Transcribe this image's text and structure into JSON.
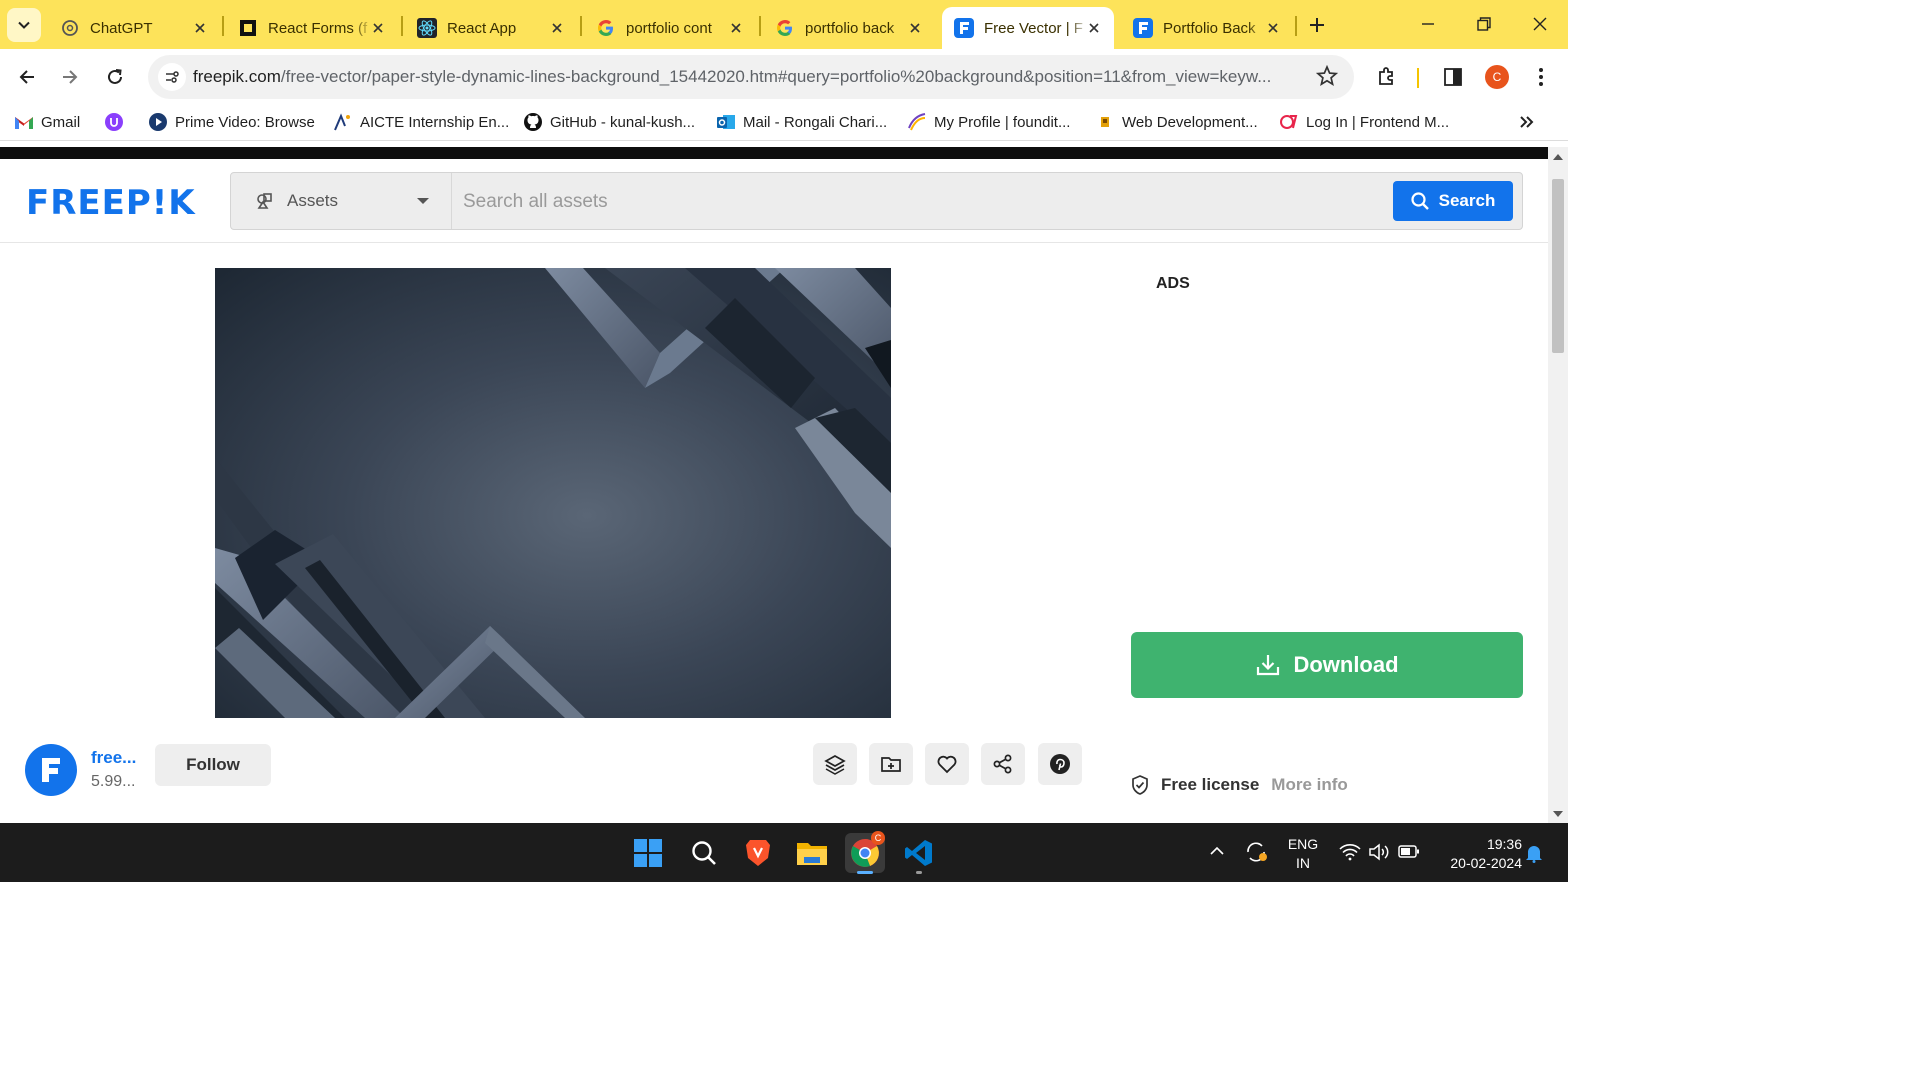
{
  "browser": {
    "tabs": [
      {
        "title": "ChatGPT",
        "icon": "chatgpt-icon",
        "active": false
      },
      {
        "title": "React Forms (f",
        "icon": "react-forms-icon",
        "active": false
      },
      {
        "title": "React App",
        "icon": "react-icon",
        "active": false
      },
      {
        "title": "portfolio cont",
        "icon": "google-icon",
        "active": false
      },
      {
        "title": "portfolio back",
        "icon": "google-icon",
        "active": false
      },
      {
        "title": "Free Vector | F",
        "icon": "freepik-icon",
        "active": true
      },
      {
        "title": "Portfolio Back",
        "icon": "freepik-icon",
        "active": false
      }
    ],
    "url_host": "freepik.com",
    "url_path": "/free-vector/paper-style-dynamic-lines-background_15442020.htm#query=portfolio%20background&position=11&from_view=keyw...",
    "profile_initial": "C",
    "bookmarks": [
      {
        "label": "Gmail",
        "icon": "gmail-icon"
      },
      {
        "label": "",
        "icon": "purple-circle-icon"
      },
      {
        "label": "Prime Video: Browse",
        "icon": "prime-video-icon"
      },
      {
        "label": "AICTE Internship En...",
        "icon": "aicte-icon"
      },
      {
        "label": "GitHub - kunal-kush...",
        "icon": "github-icon"
      },
      {
        "label": "Mail - Rongali Chari...",
        "icon": "outlook-icon"
      },
      {
        "label": "My Profile | foundit...",
        "icon": "foundit-icon"
      },
      {
        "label": "Web Development...",
        "icon": "bookmark-icon"
      },
      {
        "label": "Log In | Frontend M...",
        "icon": "frontend-mentor-icon"
      }
    ]
  },
  "page": {
    "logo": "FREEP!K",
    "search": {
      "category": "Assets",
      "placeholder": "Search all assets",
      "button": "Search"
    },
    "ads_label": "ADS",
    "download_label": "Download",
    "author": {
      "name": "free...",
      "count": "5.99..."
    },
    "follow_label": "Follow",
    "actions": [
      "layers-icon",
      "add-to-collection-icon",
      "heart-icon",
      "share-icon",
      "pinterest-icon"
    ],
    "license": {
      "label": "Free license",
      "more": "More info"
    }
  },
  "taskbar": {
    "apps": [
      "windows-start-icon",
      "search-icon",
      "brave-icon",
      "file-explorer-icon",
      "chrome-icon",
      "vscode-icon"
    ],
    "lang_top": "ENG",
    "lang_bottom": "IN",
    "time": "19:36",
    "date": "20-02-2024"
  },
  "colors": {
    "tabstrip": "#fde35a",
    "brand_blue": "#1273eb",
    "download_green": "#3fb36f"
  }
}
